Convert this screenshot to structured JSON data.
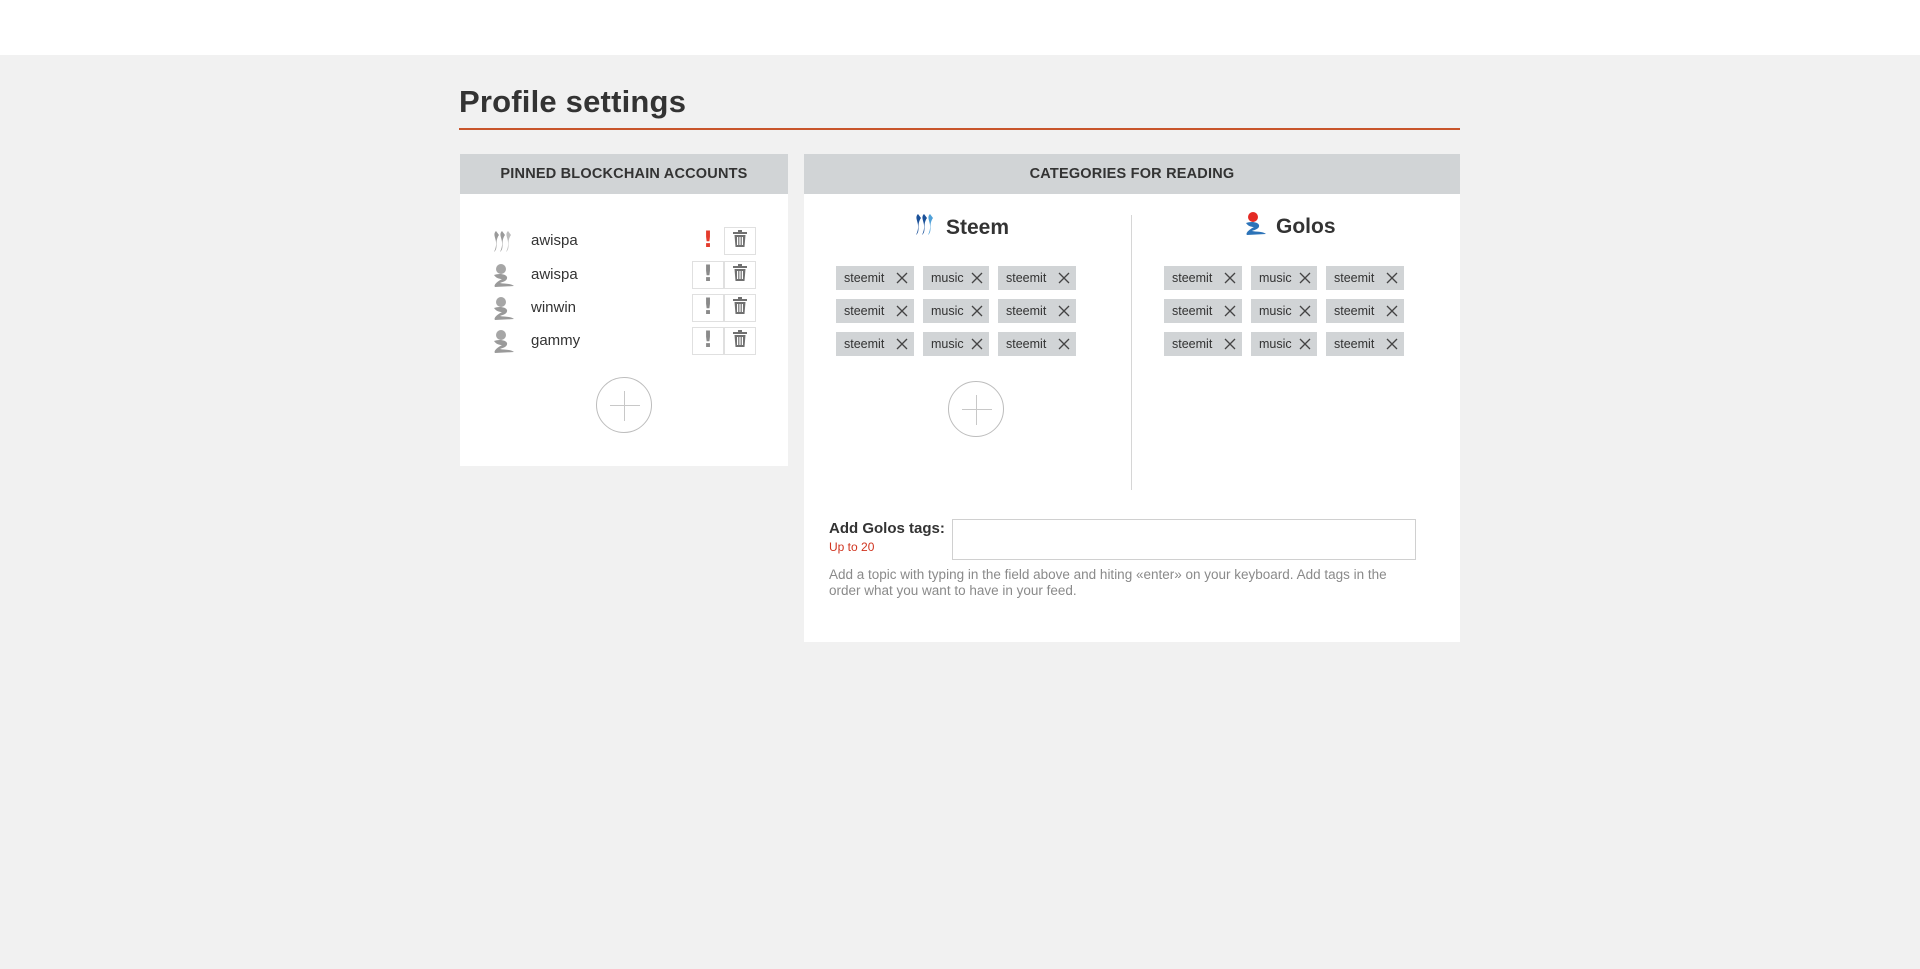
{
  "page": {
    "title": "Profile settings"
  },
  "accounts_panel": {
    "heading": "PINNED BLOCKCHAIN ACCOUNTS",
    "accounts": [
      {
        "name": "awispa",
        "network_icon": "steem-icon",
        "warning_active": true
      },
      {
        "name": "awispa",
        "network_icon": "golos-icon",
        "warning_active": false
      },
      {
        "name": "winwin",
        "network_icon": "golos-icon",
        "warning_active": false
      },
      {
        "name": "gammy",
        "network_icon": "golos-icon",
        "warning_active": false
      }
    ],
    "warn_glyph": "!",
    "add_button_icon": "plus-icon"
  },
  "categories_panel": {
    "heading": "CATEGORIES FOR READING",
    "steem": {
      "title": "Steem",
      "tags": [
        [
          "steemit",
          "music",
          "steemit"
        ],
        [
          "steemit",
          "music",
          "steemit"
        ],
        [
          "steemit",
          "music",
          "steemit"
        ]
      ]
    },
    "golos": {
      "title": "Golos",
      "tags": [
        [
          "steemit",
          "music",
          "steemit"
        ],
        [
          "steemit",
          "music",
          "steemit"
        ],
        [
          "steemit",
          "music",
          "steemit"
        ]
      ]
    },
    "add_tags": {
      "label": "Add Golos tags:",
      "limit": "Up to 20",
      "value": "",
      "placeholder": "",
      "help": "Add a topic with typing in the field above and hiting «enter» on your keyboard. Add tags in the order what you want to have in your feed."
    }
  },
  "colors": {
    "accent": "#c8552b",
    "warning": "#e43b2c",
    "steem_blue": "#1a5099",
    "golos_red": "#e42a24",
    "golos_blue": "#2c73b8",
    "panel_head": "#d1d4d6"
  }
}
